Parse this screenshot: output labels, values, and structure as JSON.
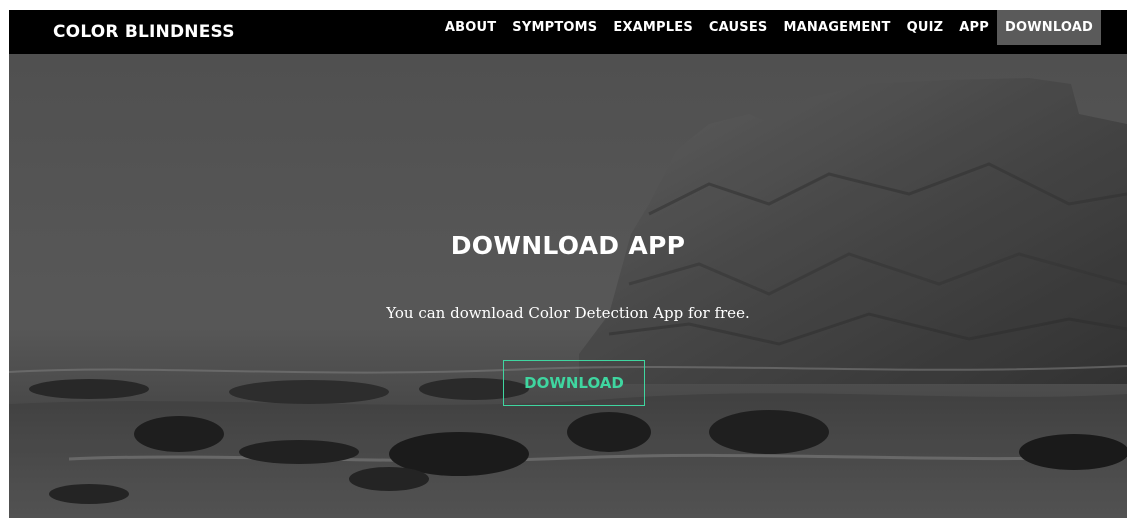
{
  "brand": "COLOR BLINDNESS",
  "nav": {
    "items": [
      {
        "label": "ABOUT"
      },
      {
        "label": "SYMPTOMS"
      },
      {
        "label": "EXAMPLES"
      },
      {
        "label": "CAUSES"
      },
      {
        "label": "MANAGEMENT"
      },
      {
        "label": "QUIZ"
      },
      {
        "label": "APP"
      },
      {
        "label": "DOWNLOAD",
        "active": true
      }
    ]
  },
  "hero": {
    "title": "DOWNLOAD APP",
    "subtitle": "You can download Color Detection App for free.",
    "button_label": "DOWNLOAD"
  },
  "colors": {
    "navbar_bg": "#000000",
    "nav_active_bg": "#5a5a5a",
    "accent": "#3fd6a0",
    "text": "#ffffff"
  }
}
